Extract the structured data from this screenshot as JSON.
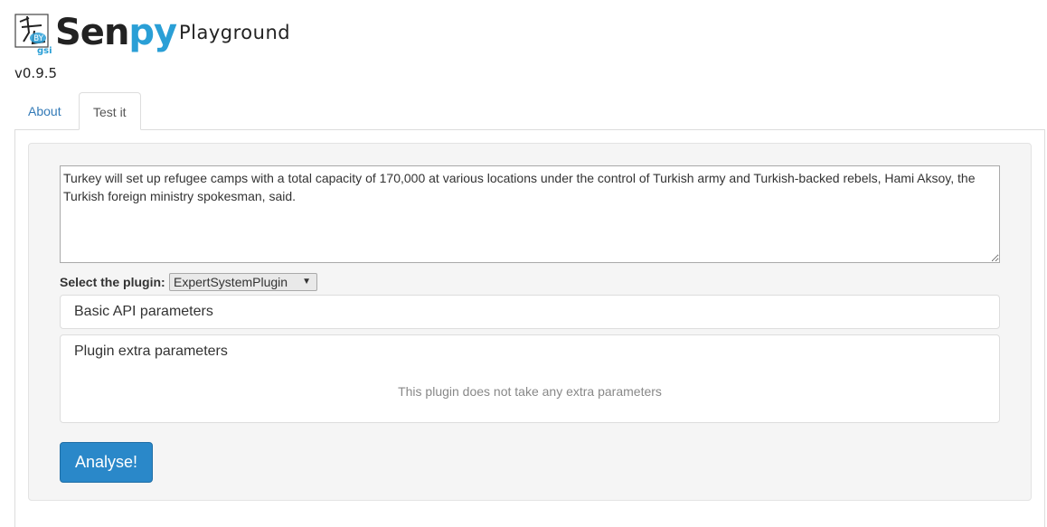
{
  "header": {
    "brand_part1": "Sen",
    "brand_part2": "py",
    "subtitle": "Playground",
    "version": "v0.9.5",
    "logo_text": "gsi"
  },
  "tabs": [
    {
      "label": "About",
      "active": false
    },
    {
      "label": "Test it",
      "active": true
    }
  ],
  "form": {
    "input_text": "Turkey will set up refugee camps with a total capacity of 170,000 at various locations under the control of Turkish army and Turkish-backed rebels, Hami Aksoy, the Turkish foreign ministry spokesman, said.",
    "plugin_label": "Select the plugin:",
    "plugin_selected": "ExpertSystemPlugin",
    "basic_panel_title": "Basic API parameters",
    "extra_panel_title": "Plugin extra parameters",
    "extra_panel_note": "This plugin does not take any extra parameters",
    "submit_label": "Analyse!"
  },
  "colors": {
    "accent": "#2a9fd6",
    "button": "#2a88c9",
    "link": "#337ab7"
  }
}
